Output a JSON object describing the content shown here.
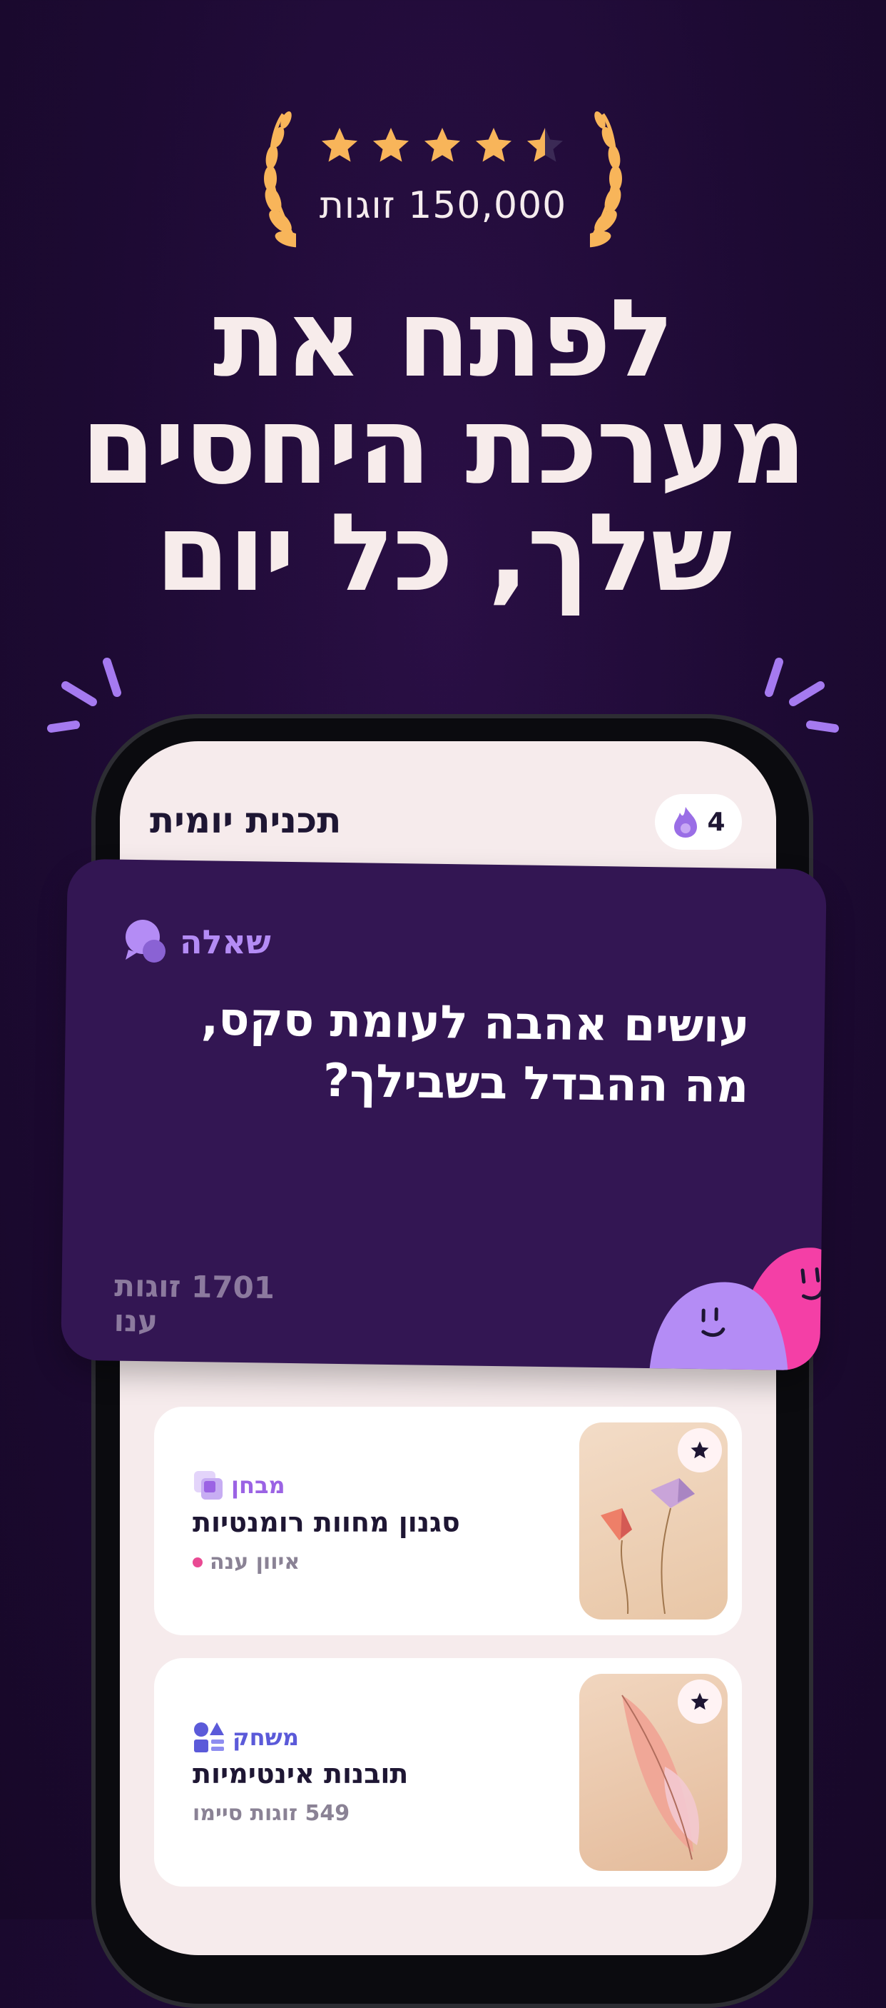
{
  "rating": {
    "stars_filled": 4.5,
    "stars_total": 5,
    "star_color": "#f8b55a",
    "couples_text": "150,000 זוגות"
  },
  "headline": {
    "line1": "לפתח את",
    "line2": "מערכת היחסים",
    "line3": "שלך, כל יום"
  },
  "phone": {
    "plan_title": "תכנית יומית",
    "streak_count": "4",
    "streak_icon": "flame-icon",
    "question_card": {
      "type_label": "שאלה",
      "type_icon": "chat-bubbles-icon",
      "question": "עושים אהבה לעומת סקס, מה ההבדל בשבילך?",
      "answered": "1701 זוגות ענו",
      "card_color": "#331653",
      "accent_purple": "#b48cf5",
      "accent_pink": "#f43fa6"
    },
    "items": [
      {
        "badge": "מבחן",
        "badge_icon": "quiz-squares-icon",
        "badge_color": "#9b63e4",
        "title": "סגנון מחוות רומנטיות",
        "meta": "איוון ענה",
        "meta_dot_color": "#e94a93",
        "thumb_icon": "paper-kites-icon",
        "favorite_icon": "star-icon"
      },
      {
        "badge": "משחק",
        "badge_icon": "game-shapes-icon",
        "badge_color": "#5b5ad9",
        "title": "תובנות אינטימיות",
        "meta": "549 זוגות סיימו",
        "thumb_icon": "feather-icon",
        "favorite_icon": "star-icon"
      }
    ]
  }
}
